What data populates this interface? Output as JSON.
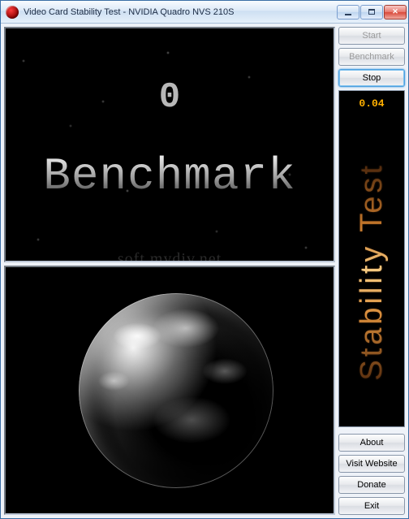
{
  "window": {
    "title": "Video Card Stability Test - NVIDIA Quadro NVS 210S"
  },
  "buttons": {
    "start": "Start",
    "benchmark": "Benchmark",
    "stop": "Stop",
    "about": "About",
    "visit_website": "Visit Website",
    "donate": "Donate",
    "exit": "Exit"
  },
  "main_view": {
    "counter": "0",
    "overlay_text": "Benchmark",
    "watermark": "soft.mydiv.net"
  },
  "side_panel": {
    "fps_value": "0.04",
    "logo_text": "Stability Test"
  }
}
